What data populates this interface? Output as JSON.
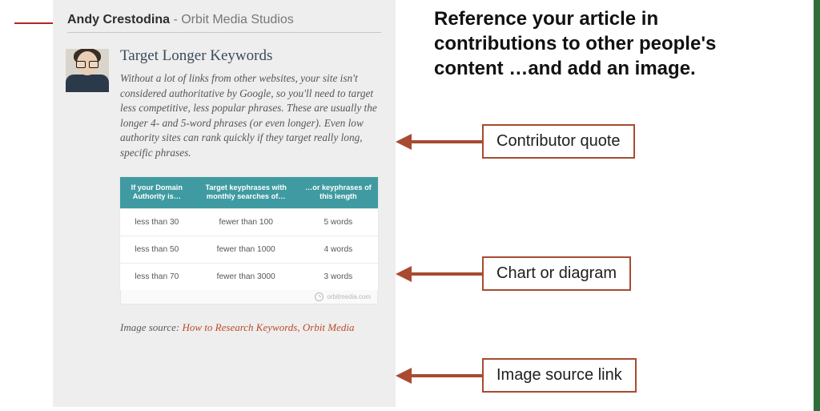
{
  "author": {
    "name": "Andy Crestodina",
    "org_sep": " - ",
    "org": "Orbit Media Studios"
  },
  "heading": "Target Longer Keywords",
  "quote": "Without a lot of links from other websites, your site isn't considered authoritative by Google, so you'll need to target less competitive, less popular phrases. These are usually the longer 4- and 5-word phrases (or even longer). Even low authority sites can rank quickly if they target really long, specific phrases.",
  "table": {
    "headers": {
      "c0": "If your Domain Authority is…",
      "c1": "Target keyphrases with monthly searches of…",
      "c2": "…or keyphrases of this length"
    },
    "rows": [
      {
        "c0": "less than 30",
        "c1": "fewer than 100",
        "c2": "5 words"
      },
      {
        "c0": "less than 50",
        "c1": "fewer than 1000",
        "c2": "4 words"
      },
      {
        "c0": "less than 70",
        "c1": "fewer than 3000",
        "c2": "3 words"
      }
    ],
    "footer_brand": "orbitmedia.com"
  },
  "source": {
    "label": "Image source: ",
    "link_text": "How to Research Keywords, Orbit Media"
  },
  "headline": "Reference your article in contributions to other people's content …and add an image.",
  "callouts": {
    "quote": "Contributor quote",
    "chart": "Chart or diagram",
    "source": "Image source link"
  },
  "chart_data": {
    "type": "table",
    "title": "Keyword targeting by Domain Authority",
    "columns": [
      "Domain Authority threshold",
      "Monthly searches ceiling",
      "Keyphrase length"
    ],
    "rows": [
      [
        "< 30",
        "< 100",
        "5 words"
      ],
      [
        "< 50",
        "< 1000",
        "4 words"
      ],
      [
        "< 70",
        "< 3000",
        "3 words"
      ]
    ]
  }
}
